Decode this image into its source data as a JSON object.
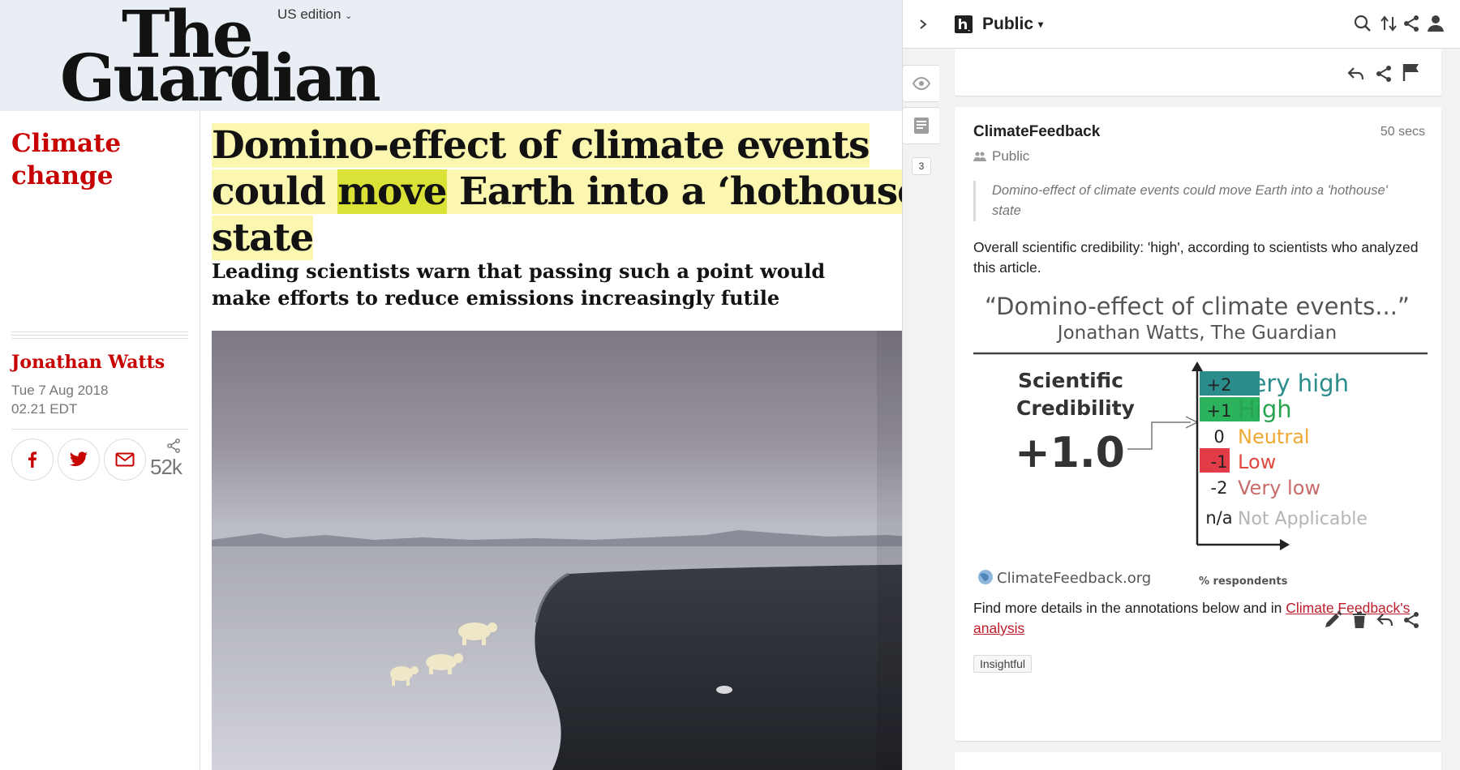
{
  "guardian": {
    "logo_line1": "The",
    "logo_line2": "Guardian",
    "edition": "US edition",
    "section": "Climate change",
    "headline": {
      "part1": "Domino-effect of climate events could ",
      "part2": "move",
      "part3": " Earth into a ‘hothouse’ state"
    },
    "standfirst": "Leading scientists warn that passing such a point would make efforts to reduce emissions increasingly futile",
    "author": "Jonathan Watts",
    "date_line1": "Tue 7 Aug 2018",
    "date_line2": "02.21 EDT",
    "share_count": "52k",
    "share_buttons": [
      "facebook-icon",
      "twitter-icon",
      "email-icon"
    ]
  },
  "hypothesis": {
    "group": "Public",
    "notes_count": "3",
    "top_icons": [
      "search-icon",
      "sort-icon",
      "share-icon",
      "user-icon"
    ],
    "annotation": {
      "user": "ClimateFeedback",
      "time": "50 secs",
      "group": "Public",
      "quote": "Domino-effect of climate events could move Earth into a 'hothouse' state",
      "body": "Overall scientific credibility: 'high', according to scientists who analyzed this article.",
      "footer_text": "Find more details in the annotations below and in ",
      "footer_link": "Climate Feedback's analysis",
      "tag": "Insightful"
    },
    "graphic": {
      "title": "“Domino-effect of climate events...”",
      "subtitle": "Jonathan Watts, The Guardian",
      "label_line1": "Scientific",
      "label_line2": "Credibility",
      "score": "+1.0",
      "scale": [
        {
          "value": "+2",
          "label": "Very high",
          "color": "#2b8c8c",
          "label_color": "#2b8c8c"
        },
        {
          "value": "+1",
          "label": "High",
          "color": "#2bb25c",
          "label_color": "#28a34f"
        },
        {
          "value": "0",
          "label": "Neutral",
          "color": "",
          "label_color": "#f0a832"
        },
        {
          "value": "-1",
          "label": "Low",
          "color": "#e23c48",
          "label_color": "#e04a3d"
        },
        {
          "value": "-2",
          "label": "Very low",
          "color": "",
          "label_color": "#c96b6b"
        },
        {
          "value": "n/a",
          "label": "Not Applicable",
          "color": "",
          "label_color": "#b5b5b5"
        }
      ],
      "source": "ClimateFeedback.org",
      "axis_label": "% respondents"
    }
  }
}
